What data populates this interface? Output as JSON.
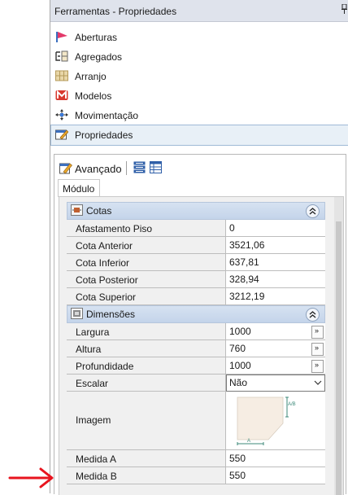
{
  "window": {
    "title": "Ferramentas - Propriedades"
  },
  "tools": [
    {
      "label": "Aberturas",
      "icon": "aberturas-icon"
    },
    {
      "label": "Agregados",
      "icon": "agregados-icon"
    },
    {
      "label": "Arranjo",
      "icon": "arranjo-icon"
    },
    {
      "label": "Modelos",
      "icon": "modelos-icon"
    },
    {
      "label": "Movimentação",
      "icon": "movimentacao-icon"
    },
    {
      "label": "Propriedades",
      "icon": "propriedades-icon",
      "selected": true
    }
  ],
  "toolbar": {
    "advanced_label": "Avançado"
  },
  "tab": {
    "label": "Módulo"
  },
  "sections": {
    "cotas": {
      "label": "Cotas",
      "rows": [
        {
          "name": "Afastamento Piso",
          "value": "0"
        },
        {
          "name": "Cota Anterior",
          "value": "3521,06"
        },
        {
          "name": "Cota Inferior",
          "value": "637,81"
        },
        {
          "name": "Cota Posterior",
          "value": "328,94"
        },
        {
          "name": "Cota Superior",
          "value": "3212,19"
        }
      ]
    },
    "dimensoes": {
      "label": "Dimensões",
      "rows": [
        {
          "name": "Largura",
          "value": "1000",
          "button": "»"
        },
        {
          "name": "Altura",
          "value": "760",
          "button": "»"
        },
        {
          "name": "Profundidade",
          "value": "1000",
          "button": "»"
        },
        {
          "name": "Escalar",
          "value": "Não"
        },
        {
          "name": "Imagem",
          "thumb_labels": {
            "side": "A/B",
            "bottom": "A"
          }
        },
        {
          "name": "Medida A",
          "value": "550"
        },
        {
          "name": "Medida B",
          "value": "550"
        }
      ]
    }
  },
  "colors": {
    "section_header": "#c4d4ea",
    "selected_tool": "#e8f0f7",
    "arrow": "#e8141e"
  }
}
